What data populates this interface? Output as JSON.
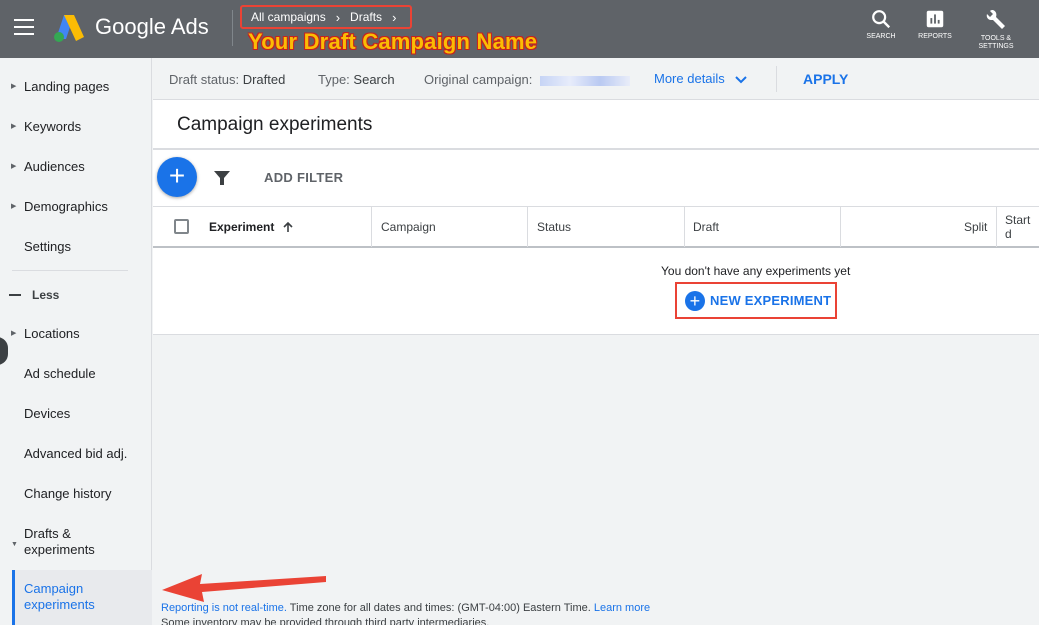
{
  "header": {
    "brand": "Google Ads",
    "breadcrumb": [
      "All campaigns",
      "Drafts"
    ],
    "breadcrumb_sep": "›",
    "annotation_title": "Your Draft Campaign Name",
    "tools": [
      {
        "icon": "search-icon",
        "label": "SEARCH"
      },
      {
        "icon": "reports-icon",
        "label": "REPORTS"
      },
      {
        "icon": "wrench-icon",
        "label_line1": "TOOLS &",
        "label_line2": "SETTINGS"
      }
    ]
  },
  "sidebar": {
    "items_top": [
      {
        "label": "Landing pages",
        "has_caret": true
      },
      {
        "label": "Keywords",
        "has_caret": true
      },
      {
        "label": "Audiences",
        "has_caret": true
      },
      {
        "label": "Demographics",
        "has_caret": true
      },
      {
        "label": "Settings",
        "has_caret": false
      }
    ],
    "less_label": "Less",
    "items_bottom": [
      {
        "label": "Locations",
        "has_caret": true
      },
      {
        "label": "Ad schedule",
        "has_caret": false
      },
      {
        "label": "Devices",
        "has_caret": false
      },
      {
        "label": "Advanced bid adj.",
        "has_caret": false
      },
      {
        "label": "Change history",
        "has_caret": false
      }
    ],
    "drafts_line1": "Drafts &",
    "drafts_line2": "experiments",
    "active_line1": "Campaign",
    "active_line2": "experiments"
  },
  "status_bar": {
    "draft_status_label": "Draft status:",
    "draft_status_value": "Drafted",
    "type_label": "Type:",
    "type_value": "Search",
    "original_label": "Original campaign:",
    "more_details": "More details",
    "apply": "APPLY"
  },
  "main": {
    "title": "Campaign experiments",
    "add_filter": "ADD FILTER",
    "columns": [
      "Experiment",
      "Campaign",
      "Status",
      "Draft",
      "Split",
      "Start d"
    ],
    "empty_message": "You don't have any experiments yet",
    "new_experiment": "NEW EXPERIMENT"
  },
  "footer": {
    "reporting_link": "Reporting is not real-time.",
    "timezone_text": " Time zone for all dates and times: (GMT-04:00) Eastern Time. ",
    "learn_more": "Learn more",
    "inventory_text": "Some inventory may be provided through third party intermediaries."
  },
  "colors": {
    "header_bg": "#5f6368",
    "accent": "#1a73e8",
    "annotation_red": "#ea4335",
    "annotation_yellow": "#fbbc04"
  }
}
